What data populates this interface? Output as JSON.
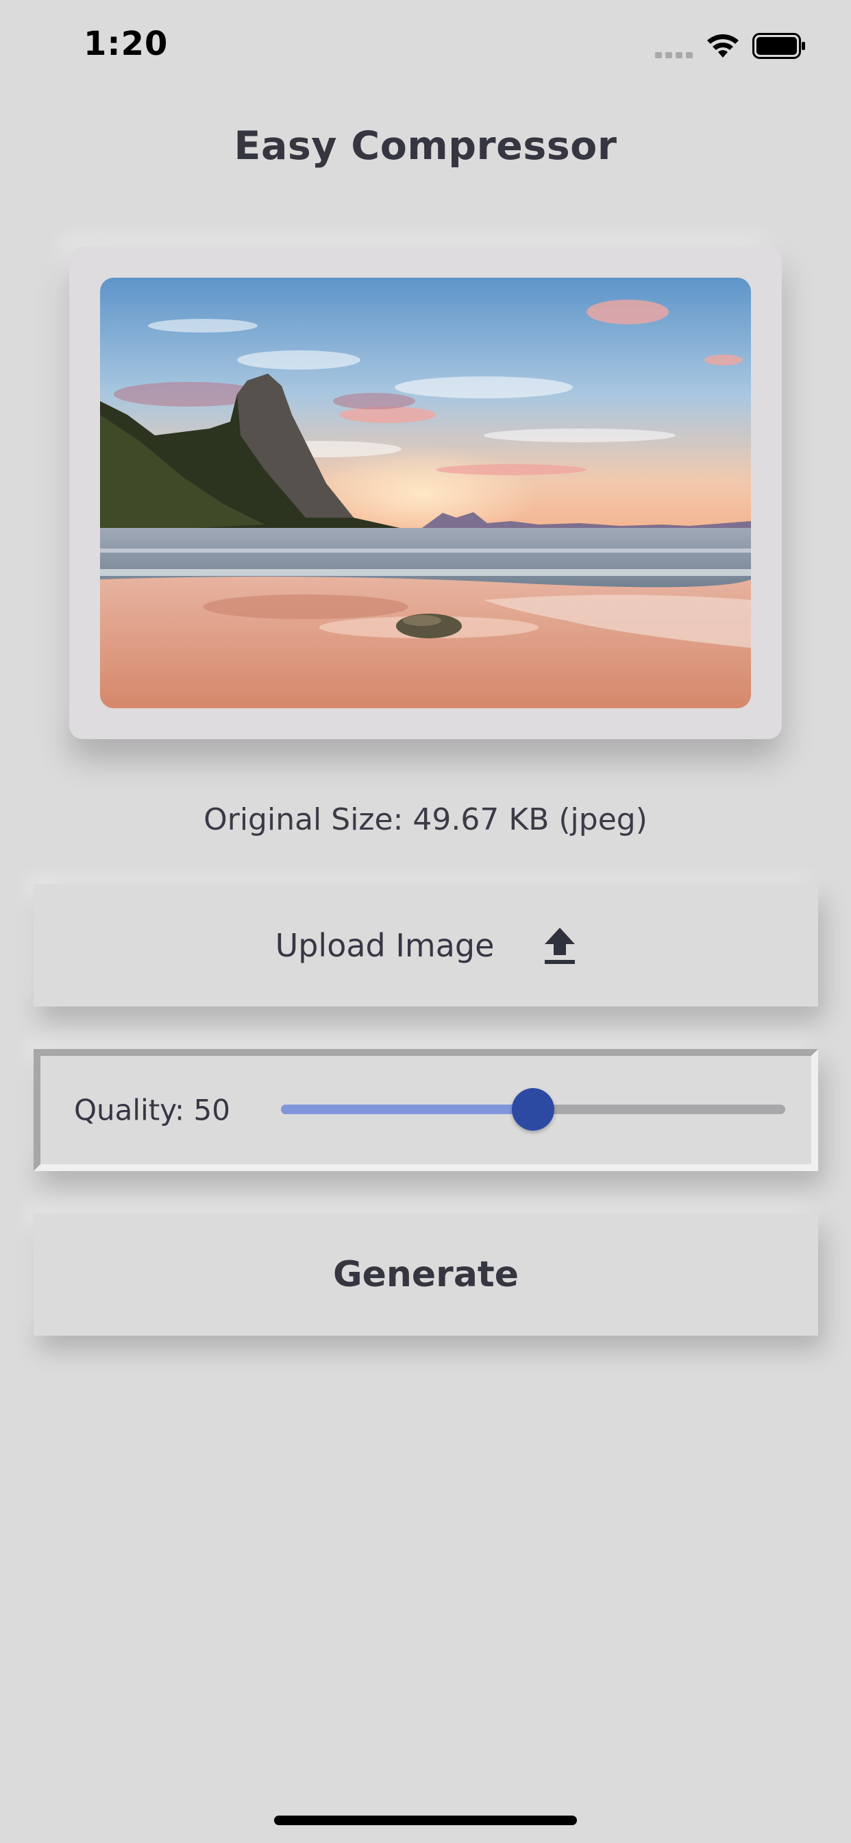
{
  "status_bar": {
    "time": "1:20"
  },
  "header": {
    "title": "Easy Compressor"
  },
  "preview": {
    "image_description": "beach at sunset"
  },
  "info": {
    "original_size": "Original Size: 49.67 KB (jpeg)"
  },
  "upload": {
    "label": "Upload Image",
    "icon": "upload-icon"
  },
  "quality": {
    "label": "Quality: 50",
    "value": 50,
    "max": 100,
    "fill_color": "#7f96dc",
    "thumb_color": "#2d4aa3",
    "track_color": "#a8a8aa"
  },
  "generate": {
    "label": "Generate"
  },
  "colors": {
    "background": "#dcdbdc",
    "text": "#35363f"
  }
}
